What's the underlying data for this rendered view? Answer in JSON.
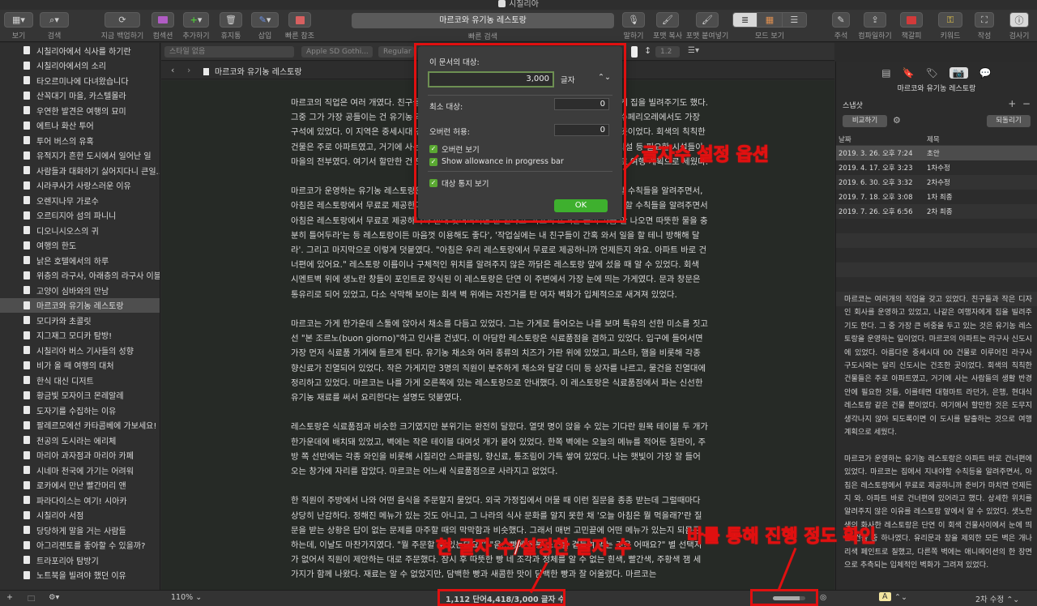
{
  "window": {
    "title": "시칠리아"
  },
  "toolbar": {
    "view": "보기",
    "search": "검색",
    "backup": "지금 백업하기",
    "compose": "컴섹션",
    "add": "추가하기",
    "trash": "휴지통",
    "insert": "삽입",
    "quick_ref": "빠른 참조",
    "quick_search_value": "마르코와 유기농 레스토랑",
    "quick_search_label": "빠른 검색",
    "speak": "말하기",
    "copy_format": "포맷 복사",
    "paste_format": "포맷 붙여넣기",
    "view_mode": "모드 보기",
    "comment": "주석",
    "compile": "컴파일하기",
    "bookmark": "책갈피",
    "keywords": "키워드",
    "compose_mode": "작성",
    "inspector": "검사기"
  },
  "binder": {
    "items": [
      "시칠리아에서 식사를 하기란",
      "시칠리아에서의 소리",
      "타오르미나에 다녀왔습니다",
      "산꼭대기 마을, 카스텔몰라",
      "우연한 발견은 여행의 묘미",
      "에트나 화산 투어",
      "투어 버스의 유혹",
      "유적지가 흔한 도시에서 일어난 일",
      "사람들과 대화하기 싫어지다니 큰일...",
      "시라쿠사가 사랑스러운 이유",
      "오렌지나무 가로수",
      "오르티지아 섬의 파니니",
      "디오니시오스의 귀",
      "여행의 한도",
      "낡은 호텔에서의 하루",
      "위층의 라구사, 아래층의 라구사 이블라",
      "고양이 심바와의 만남",
      "마르코와 유기농 레스토랑",
      "모디카와 초콜릿",
      "지그재그 모디카 탐방!",
      "시칠리아 버스 기사들의 성향",
      "비가 올 때 여행의 대처",
      "한식 대신 디저트",
      "황금빛 모자이크 몬레알레",
      "도자기를 수집하는 이유",
      "팔레르모에선 카타콤베에 가보세요!",
      "천공의 도시라는 에리체",
      "마리아 과자점과 마리아 카페",
      "시네마 천국에 가기는 어려워",
      "로카에서 만난 빨간머리 앤",
      "파라다이스는 여기! 시아카",
      "시칠리아 서점",
      "당당하게 말을 거는 사람들",
      "아그리젠토를 좋아할 수 있을까?",
      "트라포리아 탐방기",
      "노트북을 빌려야 했던 이유"
    ],
    "selected_index": 17
  },
  "format_bar": {
    "style": "스타일 없음",
    "font": "Apple SD Gothi...",
    "weight": "Regular",
    "line_spacing": "1.2"
  },
  "header": {
    "doc_title": "마르코와 유기농 레스토랑"
  },
  "editor": {
    "paragraphs": [
      "마르코의 직업은 여러 개였다. 친구들과 작은 디자인 회사를 운영하고 있었고, 나같은 여행자에게 집을 빌려주기도 했다. 그중 그가 가장 공들이는 건 유기농 레스토랑을 운영하는 일이었다. 마르코의 아파트는 라구사 수페리오레에서도 가장 구석에 있었다. 이 지역은 중세시대 건물로 이루어진 라구사 구도시와는 달리 신도시라 불리는 곳이었다. 회색의 칙칙한 건물은 주로 아파트였고, 거기에 사는 사람들의 생활 반경에는 대형마트 라던가, 은행, 현대식 시설 등 필요한 시설들이 마을의 전부였다. 여기서 할만한 건 도무지 생각나지 않아 되도록이면 이 도시를 탈출하는 것으로 여행 계획으로 세웠다.",
      "마르코가 운영하는 유기농 레스토랑은 아파트 바로 건너편에 있었다. 마르코는 집에서 지내야 할 수칙들을 알려주면서, 아침은 레스토랑에서 무료로 제공한다고 알려줬을 때, 마르코는 이 아파트에서 지내면서 지켜야 할 수칙들을 알려주면서 아침은 레스토랑에서 무료로 제공하니까 절대 잊어버리면 안 된다고 '욕조의 뜨거운 물이 가끔 안 나오면 따뜻한 물을 충분히 틀어두라'는 등 레스토랑이든 마음껏 이용해도 좋다', '작업실에는 내 친구들이 간혹 와서 일을 할 테니 방해해 달라'. 그리고 마지막으로 이렇게 덧붙였다. \"아침은 우리 레스토랑에서 무료로 제공하니까 언제든지 와요. 아파트 바로 건너편에 있어요.\" 레스토랑 이름이나 구체적인 위치를 알려주지 않은 까닭은 레스토랑 앞에 섰을 때 알 수 있었다. 회색 시멘트벽 위에 생노란 창들이 포인트로 장식된 이 레스토랑은 단연 이 주변에서 가장 눈에 띄는 가게였다. 문과 창문은 통유리로 되어 있었고, 다소 삭막해 보이는 회색 벽 위에는 자전거를 탄 여자 벽화가 입체적으로 새겨져 있었다.",
      "마르코는 가게 한가운데 스툴에 앉아서 채소를 다듬고 있었다. 그는 가게로 들어오는 나를 보며 특유의 선한 미소를 짓고선 \"본 조르노(buon giorno)\"하고 인사를 건넸다. 이 아담한 레스토랑은 식료품점을 겸하고 있었다. 입구에 들어서면 가장 먼저 식료품 가게에 들르게 된다. 유기농 채소와 여러 종류의 치즈가 가판 위에 있었고, 파스타, 햄을 비롯해 각종 향신료가 진열되어 있었다. 작은 가게지만 3명의 직원이 분주하게 채소와 달걀 더미 등 상자를 나르고, 물건을 진열대에 정리하고 있었다. 마르코는 나를 가게 오른쪽에 있는 레스토랑으로 안내했다. 이 레스토랑은 식료품점에서 파는 신선한 유기농 재료를 써서 요리한다는 설명도 덧붙였다.",
      "레스토랑은 식료품점과 비슷한 크기였지만 분위기는 완전히 달랐다. 열댓 명이 앉을 수 있는 기다란 원목 테이블 두 개가 한가운데에 배치돼 있었고, 벽에는 작은 테이블 대여섯 개가 붙어 있었다. 한쪽 벽에는 오늘의 메뉴를 적어둔 칠판이, 주방 쪽 선반에는 각종 와인을 비롯해 시칠리안 스파클링, 향신료, 통조림이 가득 쌓여 있었다. 나는 햇빛이 가장 잘 들어오는 창가에 자리를 잡았다. 마르코는 어느새 식료품점으로 사라지고 없었다.",
      "한 직원이 주방에서 나와 어떤 음식을 주문할지 물었다. 외국 가정집에서 머물 때 이런 질문을 종종 받는데 그럴때마다 상당히 난감하다. 정해진 메뉴가 있는 것도 아니고, 그 나라의 식사 문화를 알지 못한 채 '오늘 아침은 뭘 먹을래?'란 질문을 받는 상황은 답이 없는 문제를 마주할 때의 막막함과 비슷했다. 그래서 매번 고민끝에 어떤 메뉴가 있는지 되묻곤 하는데, 이날도 마찬가지였다. \"뭘 주문할 수 있는데요?\" \"음...빵에 전통 소스를 곁들여 먹는 것은 어때요?\" 별 선택지가 없어서 직원이 제안하는 대로 주문했다. 잠시 후 따뜻한 빵 네 조각과 정체를 알 수 없는 흰색, 빨간색, 주황색 잼 세 가지가 함께 나왔다. 재료는 알 수 없었지만, 담백한 빵과 새콤한 맛이 담백한 빵과 잘 어울렸다. 마르코는"
    ]
  },
  "popover": {
    "target_label": "이 문서의 대상:",
    "target_value": "3,000",
    "unit": "글자",
    "min_label": "최소 대상:",
    "min_value": "0",
    "overrun_label": "오버런 허용:",
    "overrun_value": "0",
    "check_overrun": "오버런 보기",
    "check_allowance": "Show allowance in progress bar",
    "check_notify": "대상 통지 보기",
    "ok": "OK"
  },
  "inspector": {
    "doc_title": "마르코와 유기농 레스토랑",
    "snapshots_label": "스냅샷",
    "compare": "비교하기",
    "rollback": "되돌리기",
    "col_date": "날짜",
    "col_title": "제목",
    "rows": [
      {
        "date": "2019. 3. 26. 오후 7:24",
        "title": "초안"
      },
      {
        "date": "2019. 4. 17. 오후 3:23",
        "title": "1차수정"
      },
      {
        "date": "2019. 6. 30. 오후 3:32",
        "title": "2차수정"
      },
      {
        "date": "2019. 7. 18. 오후 3:08",
        "title": "1차 최종"
      },
      {
        "date": "2019. 7. 26. 오후 6:56",
        "title": "2차 최종"
      }
    ],
    "snapshot_text": [
      "마르코는 여러개의 직업을 갖고 있었다. 친구들과 작은 디자인 회사를 운영하고 있었고, 나같은 여행자에게 집을 빌려주기도 한다. 그 중 가장 큰 비중을 두고 있는 것은 유기농 레스토랑을 운영하는 일이었다. 마르코의 아파트는 라구사 신도시에 있었다. 아름다운 중세시대 00 건물로 이루어진 라구사 구도시와는 달리 신도시는 건조한 곳이었다. 회색의 칙칙한 건물들은 주로 아파트였고, 거기에 사는 사람들의 생활 반경안에 필요한 것들, 이를테면 대형마트 라던가, 은행, 현대식 레스토랑 같은 건물 뿐이었다. 여기에서 할만한 것은 도무지 생각나지 않아 되도록이면 이 도시를 탈출하는 것으로 여행 계획으로 세웠다.",
      "마르코가 운영하는 유기농 레스토랑은 아파트 바로 건너편에 있었다. 마르코는 집에서 지내야할 수칙등을 알려주면서, 아침은 레스토랑에서 무료로 제공하니까 준비가 마치면 언제든지 와. 아파트 바로 건너편에 있어라고 했다. 상세한 위치를 알려주지 않은 이유를 레스토랑 앞에서 알 수 있었다. 샛노란색의 화사한 레스토랑은 단연 이 회색 건물사이에서 눈에 띄는 건물 중 하나였다. 유리문과 창을 제외한 모든 벽은 개나리색 페인트로 칠했고, 다른쪽 벽에는 애니메이션의 한 장면으로 추측되는 입체적인 벽화가 그려져 있었다."
    ],
    "rev_label": "2차 수정"
  },
  "footer": {
    "zoom": "110%",
    "word_count": "1,112 단어",
    "char_count": "4,418/3,000 글자 수",
    "progress_fraction": 0.82,
    "bookmark_letter": "A"
  },
  "annotations": {
    "target_options": "글자수 설정 옵션",
    "current_count": "현 글자 수/설정한 글자 수",
    "progress": "바를 통해 진행 정도 확인"
  },
  "colors": {
    "annotation": "#e01010",
    "ok_green": "#3eb02e",
    "check_green": "#5aa832"
  }
}
